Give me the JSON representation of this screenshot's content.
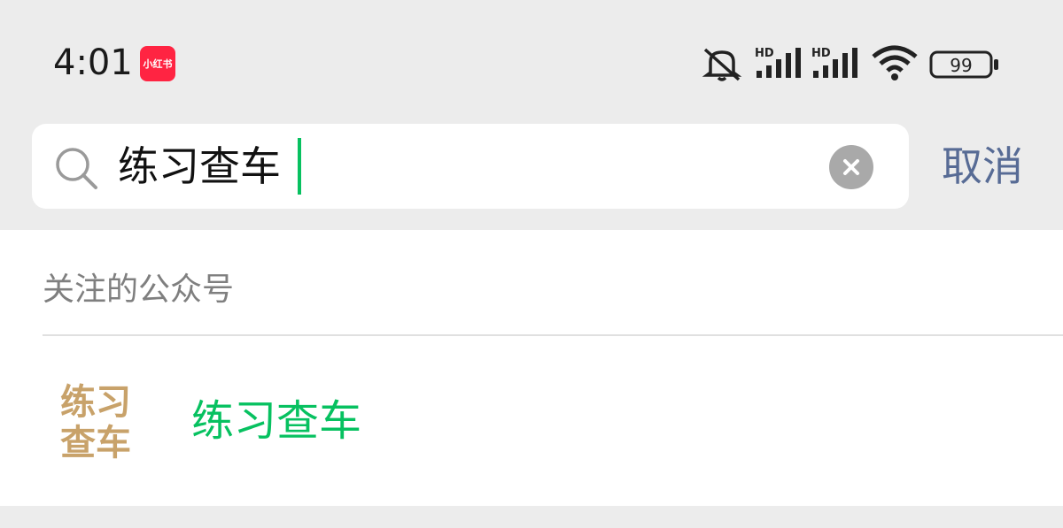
{
  "status_bar": {
    "time": "4:01",
    "app_badge": "小红书",
    "icons": [
      "mute-bell-icon",
      "signal-hd-icon",
      "signal-hd-icon",
      "wifi-icon",
      "battery-icon"
    ],
    "network_label_1": "HD",
    "network_label_2": "HD",
    "battery_level": "99"
  },
  "search": {
    "query": "练习查车",
    "cancel_label": "取消"
  },
  "results": {
    "section_title": "关注的公众号",
    "items": [
      {
        "avatar_line1": "练习",
        "avatar_line2": "查车",
        "name": "练习查车"
      }
    ]
  },
  "colors": {
    "accent": "#07c160",
    "link": "#576b95",
    "avatar_text": "#c8a26a"
  }
}
